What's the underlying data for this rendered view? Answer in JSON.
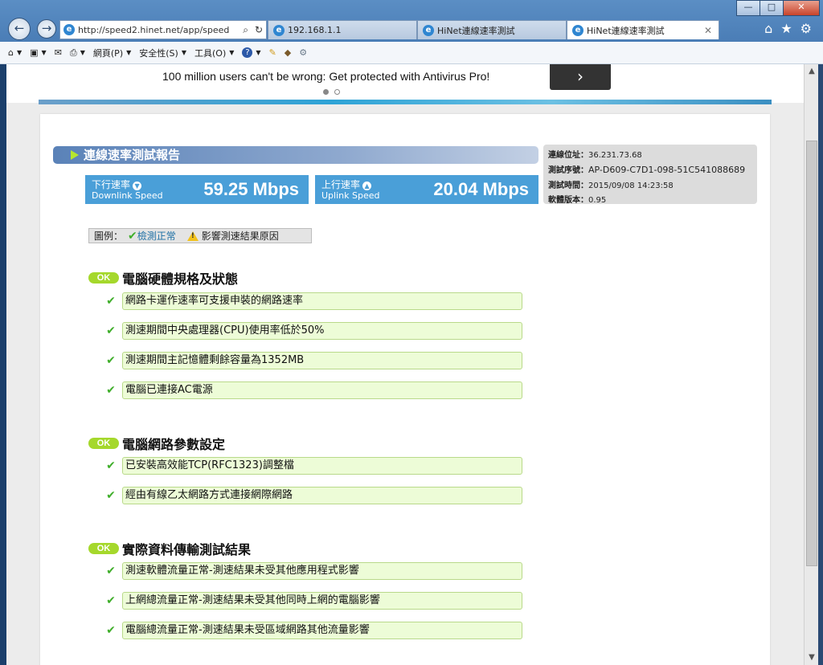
{
  "browser": {
    "address_url": "http://speed2.hinet.net/app/speed",
    "tabs": [
      {
        "label": "192.168.1.1"
      },
      {
        "label": "HiNet連線速率測試"
      },
      {
        "label": "HiNet連線速率測試"
      }
    ],
    "window_buttons": {
      "minimize": "—",
      "maximize": "□",
      "close": "✕"
    },
    "toolbar": {
      "page_menu": "網頁(P)",
      "safety_menu": "安全性(S)",
      "tools_menu": "工具(O)"
    }
  },
  "ad": {
    "text": "100 million users can't be wrong: Get protected with Antivirus Pro!",
    "next_glyph": "›"
  },
  "report": {
    "title": "連線速率測試報告",
    "downlink": {
      "label_zh": "下行速率",
      "label_en": "Downlink Speed",
      "value": "59.25 Mbps"
    },
    "uplink": {
      "label_zh": "上行速率",
      "label_en": "Uplink Speed",
      "value": "20.04 Mbps"
    },
    "info": {
      "ip_label": "連線位址：",
      "ip_value": "36.231.73.68",
      "serial_label": "測試序號：",
      "serial_value": "AP-D609-C7D1-098-51C541088689",
      "time_label": "測試時間：",
      "time_value": "2015/09/08 14:23:58",
      "version_label": "軟體版本：",
      "version_value": "0.95"
    },
    "legend": {
      "label": "圖例：",
      "normal": "檢測正常",
      "affect": "影響測速結果原因"
    }
  },
  "sections": [
    {
      "badge": "OK",
      "title": "電腦硬體規格及狀態",
      "items": [
        "網路卡運作速率可支援申裝的網路速率",
        "測速期間中央處理器(CPU)使用率低於50%",
        "測速期間主記憶體剩餘容量為1352MB",
        "電腦已連接AC電源"
      ]
    },
    {
      "badge": "OK",
      "title": "電腦網路參數設定",
      "items": [
        "已安裝高效能TCP(RFC1323)調整檔",
        "經由有線乙太網路方式連接網際網路"
      ]
    },
    {
      "badge": "OK",
      "title": "實際資料傳輸測試結果",
      "items": [
        "測速軟體流量正常-測速結果未受其他應用程式影響",
        "上網總流量正常-測速結果未受其他同時上網的電腦影響",
        "電腦總流量正常-測速結果未受區域網路其他流量影響"
      ]
    }
  ]
}
